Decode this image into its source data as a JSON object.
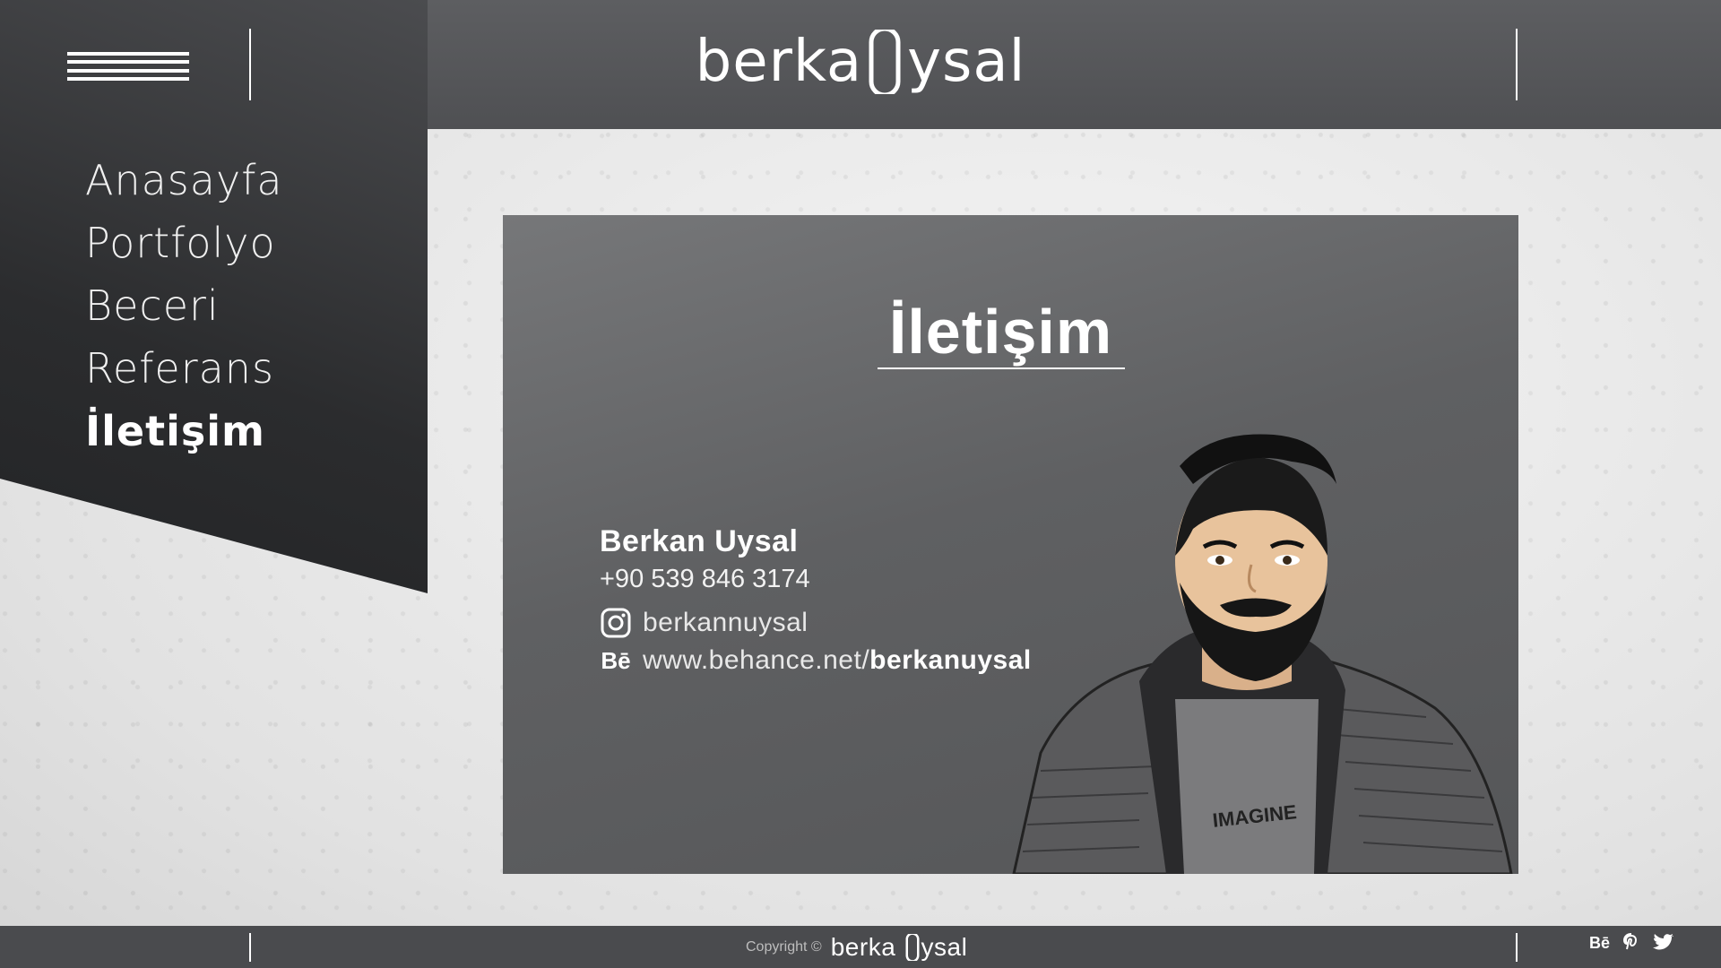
{
  "header": {
    "logo_text_left": "berka",
    "logo_text_right": "ysal",
    "menu_icon": "hamburger-menu-icon"
  },
  "nav": {
    "items": [
      {
        "label": "Anasayfa",
        "active": false
      },
      {
        "label": "Portfolyo",
        "active": false
      },
      {
        "label": "Beceri",
        "active": false
      },
      {
        "label": "Referans",
        "active": false
      },
      {
        "label": "İletişim",
        "active": true
      }
    ]
  },
  "card": {
    "title": "İletişim",
    "name": "Berkan Uysal",
    "phone": "+90 539 846 3174",
    "instagram": "berkannuysal",
    "behance_prefix": "www.behance.net/",
    "behance_handle": "berkanuysal",
    "behance_icon_label": "Bē",
    "portrait_shirt_text": "IMAGINE"
  },
  "footer": {
    "copyright_label": "Copyright ©",
    "brand_left": "berka",
    "brand_right": "ysal",
    "social": [
      {
        "icon": "behance-icon",
        "label": "Bē"
      },
      {
        "icon": "pinterest-icon",
        "label": ""
      },
      {
        "icon": "twitter-icon",
        "label": ""
      }
    ]
  },
  "colors": {
    "header_bg": "#55565a",
    "panel_dark": "#2b2c2e",
    "card_bg": "#636466",
    "text": "#ffffff"
  }
}
